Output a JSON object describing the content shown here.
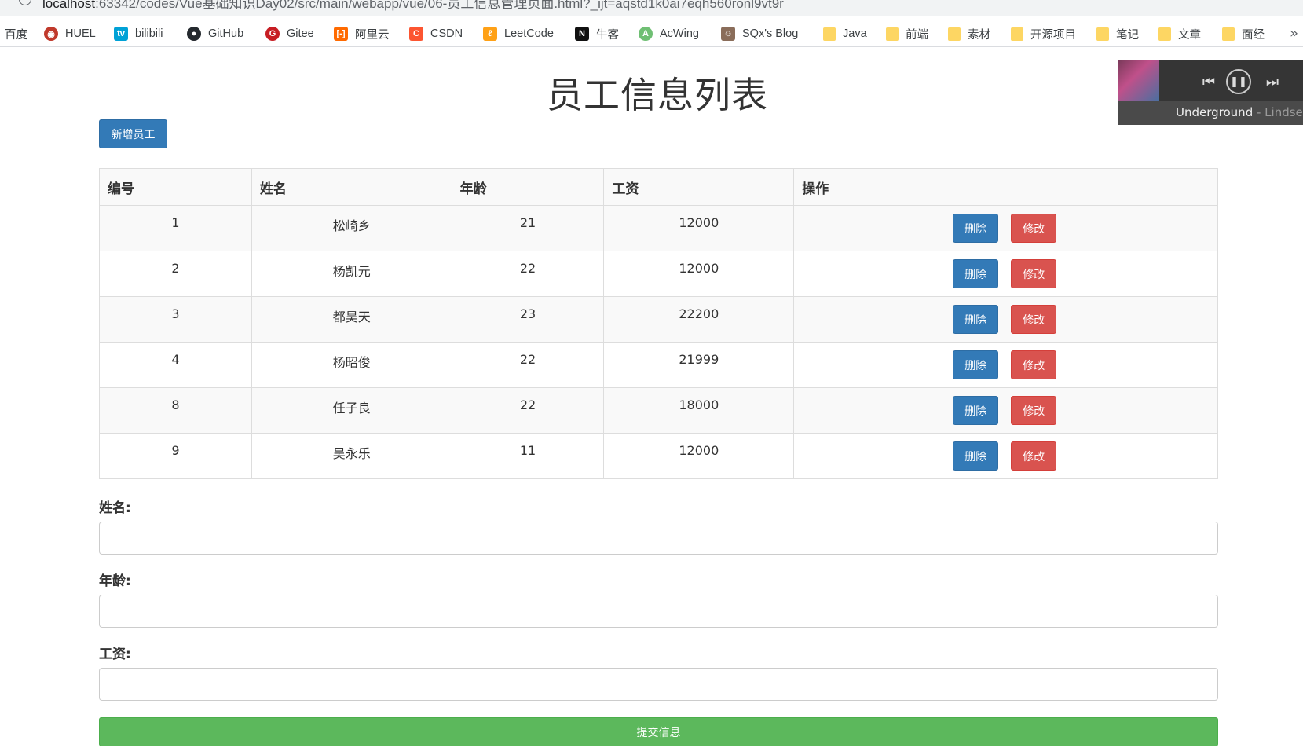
{
  "browser": {
    "url_host": "localhost",
    "url_rest": ":63342/codes/Vue基础知识Day02/src/main/webapp/vue/06-员工信息管理页面.html?_ijt=aqstd1k0ai7eqh560ronl9vt9r",
    "bookmarks": [
      {
        "label": "百度",
        "icon": "baidu-icon"
      },
      {
        "label": "HUEL",
        "icon": "huel-icon"
      },
      {
        "label": "bilibili",
        "icon": "bilibili-icon"
      },
      {
        "label": "GitHub",
        "icon": "github-icon"
      },
      {
        "label": "Gitee",
        "icon": "gitee-icon"
      },
      {
        "label": "阿里云",
        "icon": "aliyun-icon"
      },
      {
        "label": "CSDN",
        "icon": "csdn-icon"
      },
      {
        "label": "LeetCode",
        "icon": "leetcode-icon"
      },
      {
        "label": "牛客",
        "icon": "nowcoder-icon"
      },
      {
        "label": "AcWing",
        "icon": "acwing-icon"
      },
      {
        "label": "SQx's Blog",
        "icon": "blog-icon"
      },
      {
        "label": "Java",
        "icon": "folder-icon"
      },
      {
        "label": "前端",
        "icon": "folder-icon"
      },
      {
        "label": "素材",
        "icon": "folder-icon"
      },
      {
        "label": "开源项目",
        "icon": "folder-icon"
      },
      {
        "label": "笔记",
        "icon": "folder-icon"
      },
      {
        "label": "文章",
        "icon": "folder-icon"
      },
      {
        "label": "面经",
        "icon": "folder-icon"
      }
    ],
    "more": "»"
  },
  "player": {
    "song": "Underground",
    "artist": " - Lindsey Stirling"
  },
  "page": {
    "title": "员工信息列表",
    "add_button": "新增员工"
  },
  "table": {
    "headers": [
      "编号",
      "姓名",
      "年龄",
      "工资",
      "操作"
    ],
    "rows": [
      {
        "id": "1",
        "name": "松崎乡",
        "age": "21",
        "salary": "12000"
      },
      {
        "id": "2",
        "name": "杨凯元",
        "age": "22",
        "salary": "12000"
      },
      {
        "id": "3",
        "name": "都昊天",
        "age": "23",
        "salary": "22200"
      },
      {
        "id": "4",
        "name": "杨昭俊",
        "age": "22",
        "salary": "21999"
      },
      {
        "id": "8",
        "name": "任子良",
        "age": "22",
        "salary": "18000"
      },
      {
        "id": "9",
        "name": "吴永乐",
        "age": "11",
        "salary": "12000"
      }
    ],
    "delete_label": "删除",
    "edit_label": "修改"
  },
  "form": {
    "name_label": "姓名:",
    "age_label": "年龄:",
    "salary_label": "工资:",
    "name_value": "",
    "age_value": "",
    "salary_value": "",
    "submit_label": "提交信息"
  },
  "colors": {
    "primary": "#337ab7",
    "danger": "#d9534f",
    "success": "#5cb85c"
  }
}
